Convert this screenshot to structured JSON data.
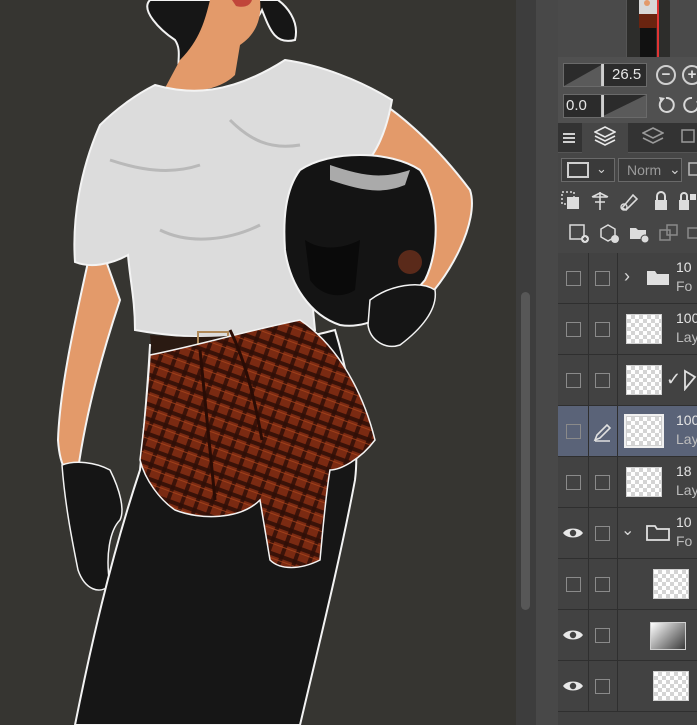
{
  "navigator": {
    "zoom_value": "26.5",
    "rotation_value": "0.0",
    "zoom_out_label": "−",
    "zoom_in_label": "+"
  },
  "layer_panel": {
    "blend_mode": "Norm",
    "layers": [
      {
        "name_line1": "10",
        "name_line2": "Fo",
        "type": "folder",
        "visible": false,
        "expanded": false
      },
      {
        "name_line1": "100",
        "name_line2": "Lay",
        "type": "raster",
        "visible": false
      },
      {
        "name_line1": "",
        "name_line2": "",
        "type": "raster",
        "visible": false,
        "checked": true
      },
      {
        "name_line1": "100",
        "name_line2": "Lay",
        "type": "raster",
        "visible": false,
        "selected": true,
        "editing": true
      },
      {
        "name_line1": "18",
        "name_line2": "Lay",
        "type": "raster",
        "visible": false
      },
      {
        "name_line1": "10",
        "name_line2": "Fo",
        "type": "folder",
        "visible": true,
        "expanded": true
      },
      {
        "name_line1": "",
        "name_line2": "",
        "type": "raster",
        "visible": false,
        "child": true
      },
      {
        "name_line1": "",
        "name_line2": "",
        "type": "gradient",
        "visible": true,
        "child": true
      },
      {
        "name_line1": "",
        "name_line2": "",
        "type": "raster",
        "visible": true,
        "child": true
      }
    ]
  },
  "colors": {
    "canvas_bg": "#363531",
    "panel_bg": "#3c3c3c",
    "selected_layer": "#5a6378",
    "accent_red": "#e03434"
  }
}
